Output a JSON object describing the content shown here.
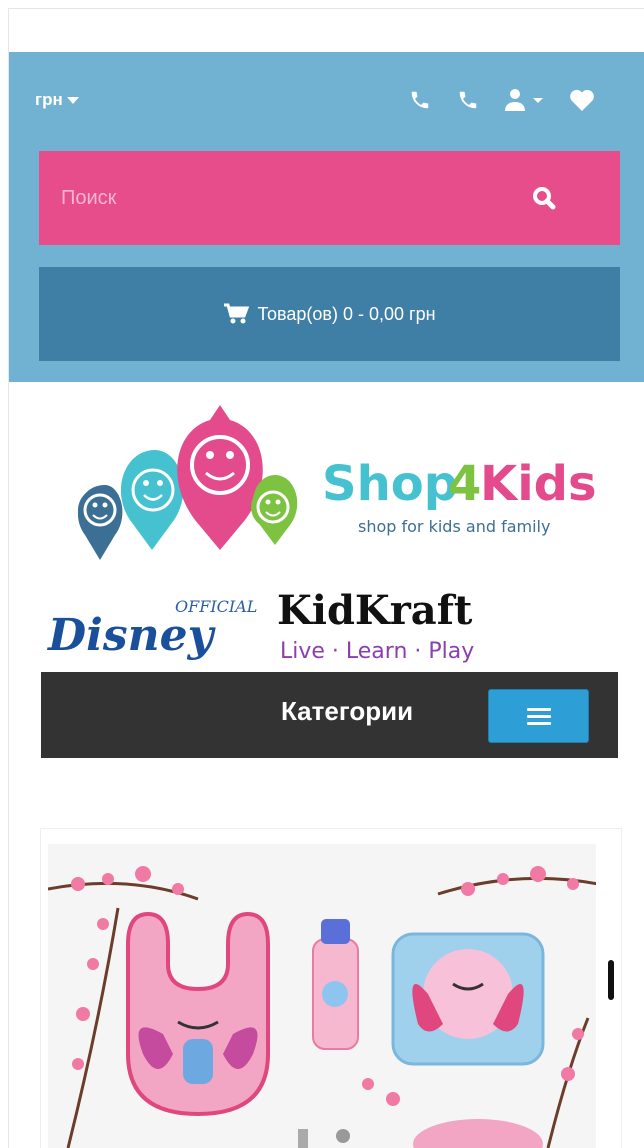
{
  "header": {
    "currency": "грн"
  },
  "search": {
    "placeholder": "Поиск"
  },
  "cart": {
    "label": "Товар(ов) 0 - 0,00 грн"
  },
  "logo": {
    "name": "Shop4Kids",
    "tagline": "shop for kids and family"
  },
  "brands": {
    "disney_official": "OFFICIAL",
    "disney": "Disney",
    "kidkraft": "KidKraft",
    "kidkraft_tagline": "Live · Learn · Play"
  },
  "categories": {
    "title": "Категории"
  },
  "colors": {
    "top_bar": "#71b2d3",
    "search_bg": "#e74c8b",
    "cart_bg": "#3f7fa5",
    "categories_bg": "#333333",
    "menu_button": "#2d9fd6"
  },
  "icons": [
    "phone-icon",
    "phone-icon",
    "user-icon",
    "heart-icon",
    "search-icon",
    "cart-icon",
    "menu-icon"
  ]
}
